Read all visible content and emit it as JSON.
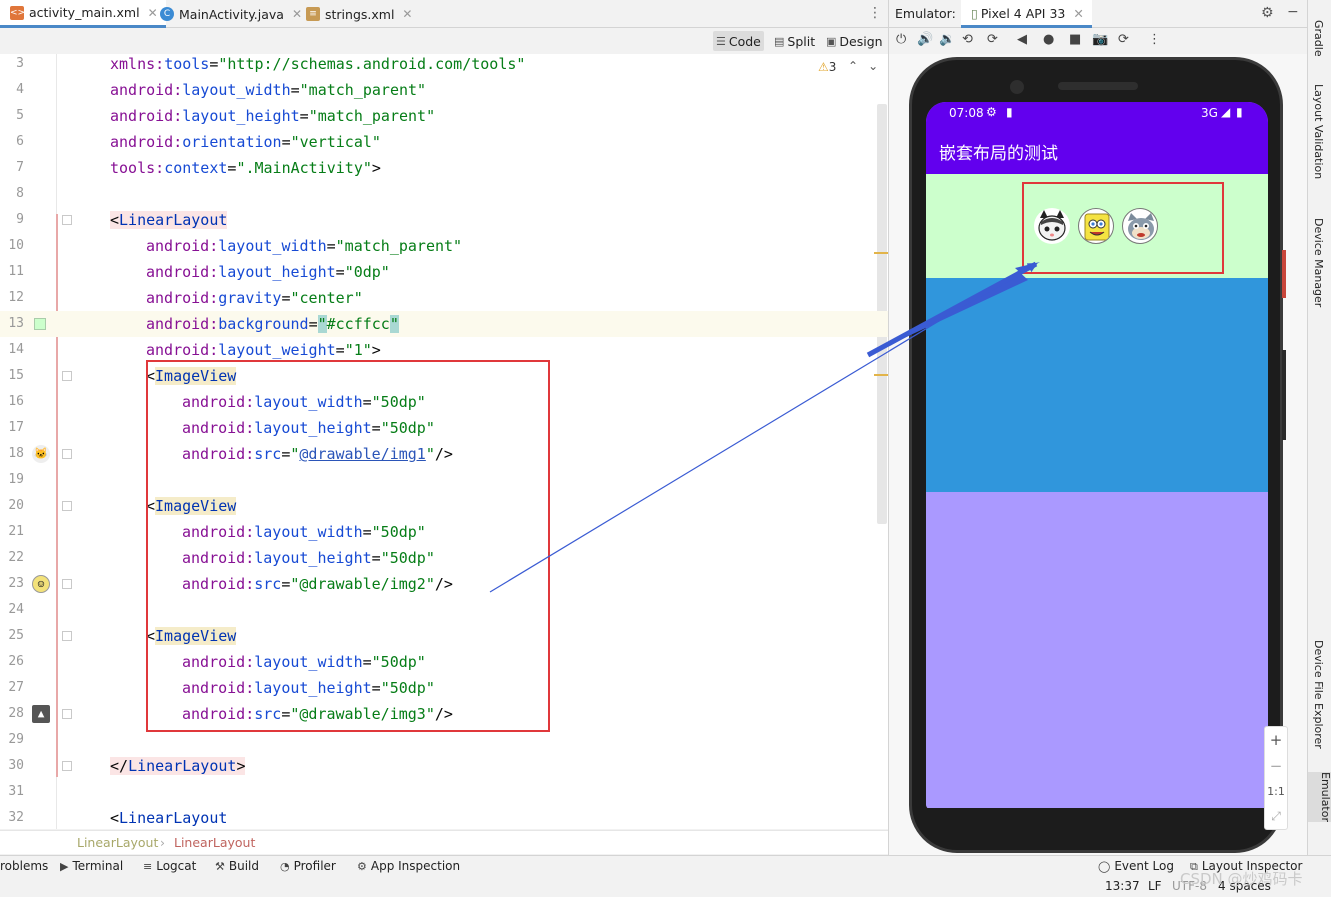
{
  "editor_tabs": [
    {
      "label": "activity_main.xml",
      "icon": "xml-file-icon",
      "active": true
    },
    {
      "label": "MainActivity.java",
      "icon": "java-class-icon",
      "active": false
    },
    {
      "label": "strings.xml",
      "icon": "xml-values-icon",
      "active": false
    }
  ],
  "view_modes": {
    "code": "Code",
    "split": "Split",
    "design": "Design",
    "active": "Code"
  },
  "inspection": {
    "warnings": "3"
  },
  "code_lines": [
    {
      "num": "3",
      "text": "xmlns:tools=\"http://schemas.android.com/tools\""
    },
    {
      "num": "4",
      "text": "android:layout_width=\"match_parent\""
    },
    {
      "num": "5",
      "text": "android:layout_height=\"match_parent\""
    },
    {
      "num": "6",
      "text": "android:orientation=\"vertical\""
    },
    {
      "num": "7",
      "text": "tools:context=\".MainActivity\">"
    },
    {
      "num": "8",
      "text": ""
    },
    {
      "num": "9",
      "text": "<LinearLayout"
    },
    {
      "num": "10",
      "text": "android:layout_width=\"match_parent\""
    },
    {
      "num": "11",
      "text": "android:layout_height=\"0dp\""
    },
    {
      "num": "12",
      "text": "android:gravity=\"center\""
    },
    {
      "num": "13",
      "text": "android:background=\"#ccffcc\""
    },
    {
      "num": "14",
      "text": "android:layout_weight=\"1\">"
    },
    {
      "num": "15",
      "text": "<ImageView"
    },
    {
      "num": "16",
      "text": "android:layout_width=\"50dp\""
    },
    {
      "num": "17",
      "text": "android:layout_height=\"50dp\""
    },
    {
      "num": "18",
      "text": "android:src=\"@drawable/img1\"/>"
    },
    {
      "num": "19",
      "text": ""
    },
    {
      "num": "20",
      "text": "<ImageView"
    },
    {
      "num": "21",
      "text": "android:layout_width=\"50dp\""
    },
    {
      "num": "22",
      "text": "android:layout_height=\"50dp\""
    },
    {
      "num": "23",
      "text": "android:src=\"@drawable/img2\"/>"
    },
    {
      "num": "24",
      "text": ""
    },
    {
      "num": "25",
      "text": "<ImageView"
    },
    {
      "num": "26",
      "text": "android:layout_width=\"50dp\""
    },
    {
      "num": "27",
      "text": "android:layout_height=\"50dp\""
    },
    {
      "num": "28",
      "text": "android:src=\"@drawable/img3\"/>"
    },
    {
      "num": "29",
      "text": ""
    },
    {
      "num": "30",
      "text": "</LinearLayout>"
    },
    {
      "num": "31",
      "text": ""
    },
    {
      "num": "32",
      "text": "<LinearLayout"
    }
  ],
  "breadcrumb": [
    "LinearLayout",
    "LinearLayout"
  ],
  "tool_windows": [
    {
      "label": "roblems",
      "icon": "problems-icon"
    },
    {
      "label": "Terminal",
      "icon": "terminal-icon"
    },
    {
      "label": "Logcat",
      "icon": "logcat-icon"
    },
    {
      "label": "Build",
      "icon": "hammer-icon"
    },
    {
      "label": "Profiler",
      "icon": "profiler-icon"
    },
    {
      "label": "App Inspection",
      "icon": "app-inspection-icon"
    },
    {
      "label": "Event Log",
      "icon": "event-log-icon"
    },
    {
      "label": "Layout Inspector",
      "icon": "layout-inspector-icon"
    }
  ],
  "status": {
    "position": "13:37",
    "line_sep": "LF",
    "encoding": "UTF-8",
    "indent": "4 spaces"
  },
  "emulator": {
    "label": "Emulator:",
    "device": "Pixel 4 API 33",
    "phone": {
      "time": "07:08",
      "network": "3G",
      "app_title": "嵌套布局的测试",
      "section_colors": [
        "#ccffcc",
        "#3096dc",
        "#aa99ff"
      ],
      "images": [
        "img1",
        "img2",
        "img3"
      ]
    },
    "zoom": {
      "in": "+",
      "out": "−",
      "actual": "1:1"
    }
  },
  "side_rail": [
    "Gradle",
    "Layout Validation",
    "Device Manager",
    "Device File Explorer",
    "Emulator"
  ],
  "watermark": "CSDN @炒鸡码卡",
  "colors": {
    "highlight_box": "#e0383b",
    "arrow": "#3a5bd3",
    "appbar": "#6200ee"
  }
}
